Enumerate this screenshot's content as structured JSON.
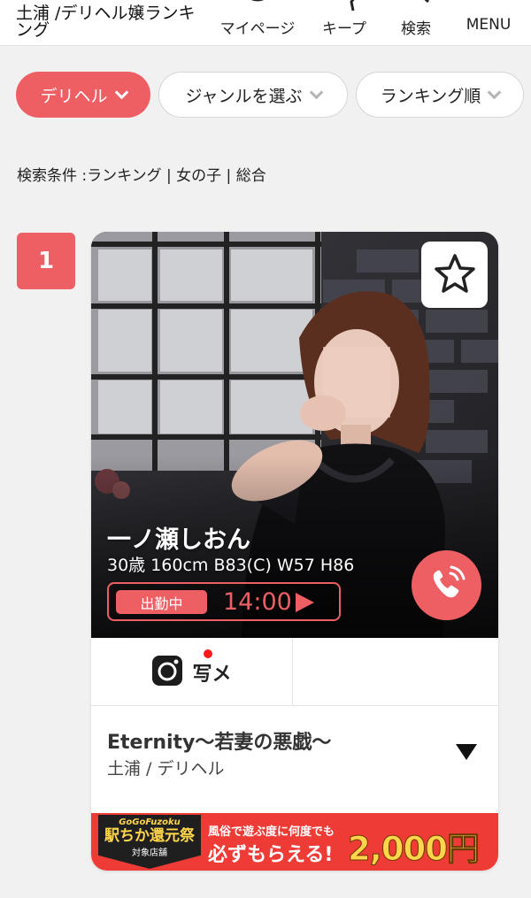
{
  "header": {
    "site_title": "土浦 /デリヘル嬢ランキング",
    "nav": [
      {
        "label": "マイページ",
        "icon": "user-icon"
      },
      {
        "label": "キープ",
        "icon": "star-icon"
      },
      {
        "label": "検索",
        "icon": "search-icon"
      },
      {
        "label": "MENU",
        "icon": "menu-icon"
      }
    ]
  },
  "filters": {
    "type": "デリヘル",
    "genre": "ジャンルを選ぶ",
    "sort": "ランキング順"
  },
  "conditions": "検索条件 :ランキング | 女の子 | 総合",
  "ranking": [
    {
      "rank": "1",
      "name": "一ノ瀬しおん",
      "stats": "30歳 160cm B83(C) W57 H86",
      "status": "出勤中",
      "time": "14:00",
      "photo_diary_label": "写メ",
      "shop_name": "Eternity〜若妻の悪戯〜",
      "shop_area": "土浦 / デリヘル"
    }
  ],
  "promo": {
    "tag_top": "GoGoFuzoku",
    "tag_main": "駅ちか還元祭",
    "tag_sub": "対象店舗",
    "text_1": "風俗で遊ぶ度に何度でも",
    "text_2": "必ずもらえる!",
    "amount": "2,000円"
  },
  "colors": {
    "accent": "#ee5f64",
    "banner": "#ef3b36",
    "banner_gold": "#ffd54a",
    "page_bg": "#f1f1f1"
  }
}
